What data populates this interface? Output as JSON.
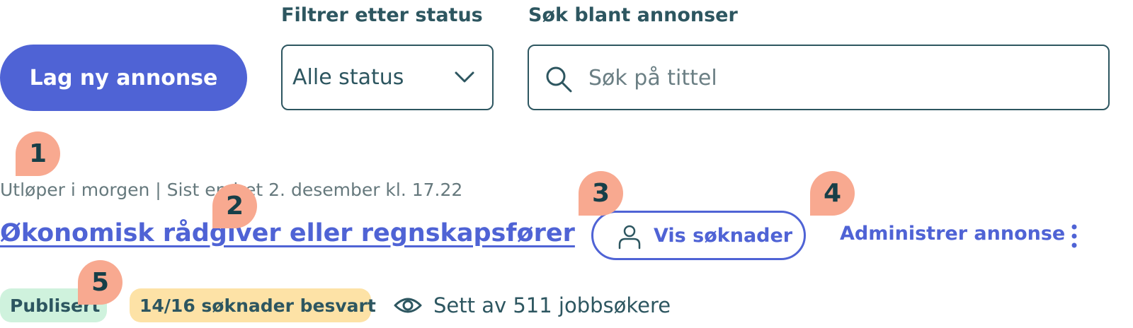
{
  "toolbar": {
    "create_button_label": "Lag ny annonse",
    "status_filter": {
      "label": "Filtrer etter status",
      "selected": "Alle status"
    },
    "search": {
      "label": "Søk blant annonser",
      "placeholder": "Søk på tittel",
      "value": ""
    }
  },
  "markers": [
    "1",
    "2",
    "3",
    "4",
    "5"
  ],
  "listing": {
    "meta": "Utløper i morgen | Sist endret 2. desember kl. 17.22",
    "title": "Økonomisk rådgiver eller regnskapsfører",
    "view_applications_label": "Vis søknader",
    "manage_label": "Administrer annonse",
    "status_badge": "Publisert",
    "applications_badge": "14/16 søknader besvart",
    "views_text": "Sett av 511 jobbsøkere"
  },
  "colors": {
    "accent": "#4f63d5",
    "text": "#2d5660",
    "marker": "#f8a990",
    "published_badge": "#cff2dd",
    "applications_badge": "#fde2a6"
  },
  "icons": {
    "status_chevron": "chevron-down-icon",
    "search": "search-icon",
    "person": "person-icon",
    "more": "more-vertical-icon",
    "views": "eye-icon"
  }
}
